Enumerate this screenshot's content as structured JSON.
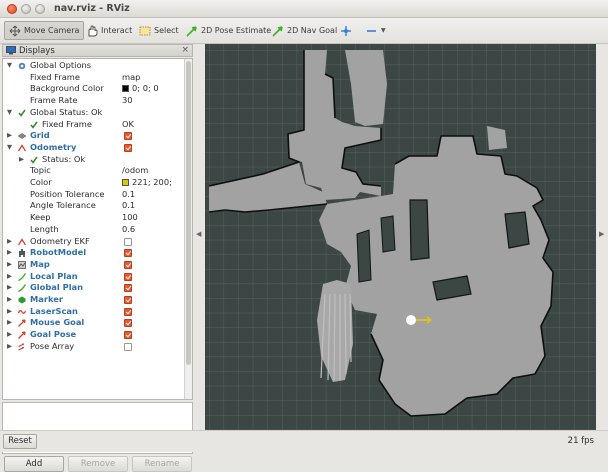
{
  "window": {
    "title": "nav.rviz - RViz"
  },
  "toolbar": {
    "tools": [
      {
        "label": "Move Camera",
        "icon": "move-camera-icon"
      },
      {
        "label": "Interact",
        "icon": "hand-icon"
      },
      {
        "label": "Select",
        "icon": "select-icon"
      },
      {
        "label": "2D Pose Estimate",
        "icon": "green-arrow-icon"
      },
      {
        "label": "2D Nav Goal",
        "icon": "green-arrow-icon"
      }
    ]
  },
  "displays": {
    "title": "Displays",
    "rows": [
      {
        "label": "Global Options",
        "value": ""
      },
      {
        "label": "Fixed Frame",
        "value": "map"
      },
      {
        "label": "Background Color",
        "value": "0; 0; 0",
        "swatch": "#000000"
      },
      {
        "label": "Frame Rate",
        "value": "30"
      },
      {
        "label": "Global Status: Ok",
        "value": ""
      },
      {
        "label": "Fixed Frame",
        "value": "OK"
      },
      {
        "label": "Grid",
        "checked": true
      },
      {
        "label": "Odometry",
        "checked": true
      },
      {
        "label": "Status: Ok",
        "value": ""
      },
      {
        "label": "Topic",
        "value": "/odom"
      },
      {
        "label": "Color",
        "value": "221; 200;",
        "swatch": "#ddc800"
      },
      {
        "label": "Position Tolerance",
        "value": "0.1"
      },
      {
        "label": "Angle Tolerance",
        "value": "0.1"
      },
      {
        "label": "Keep",
        "value": "100"
      },
      {
        "label": "Length",
        "value": "0.6"
      },
      {
        "label": "Odometry EKF",
        "checked": false
      },
      {
        "label": "RobotModel",
        "checked": true
      },
      {
        "label": "Map",
        "checked": true
      },
      {
        "label": "Local Plan",
        "checked": true
      },
      {
        "label": "Global Plan",
        "checked": true
      },
      {
        "label": "Marker",
        "checked": true
      },
      {
        "label": "LaserScan",
        "checked": true
      },
      {
        "label": "Mouse Goal",
        "checked": true
      },
      {
        "label": "Goal Pose",
        "checked": true
      },
      {
        "label": "Pose Array",
        "checked": false
      }
    ]
  },
  "buttons": {
    "add": "Add",
    "remove": "Remove",
    "rename": "Rename",
    "reset": "Reset"
  },
  "status": {
    "fps": "21 fps"
  },
  "colors": {
    "checkbox_on": "#e9582e",
    "display_name": "#2f6fa8",
    "map_free": "#a2a2a2",
    "map_bg": "#3c4745",
    "close": "#e2461f"
  }
}
